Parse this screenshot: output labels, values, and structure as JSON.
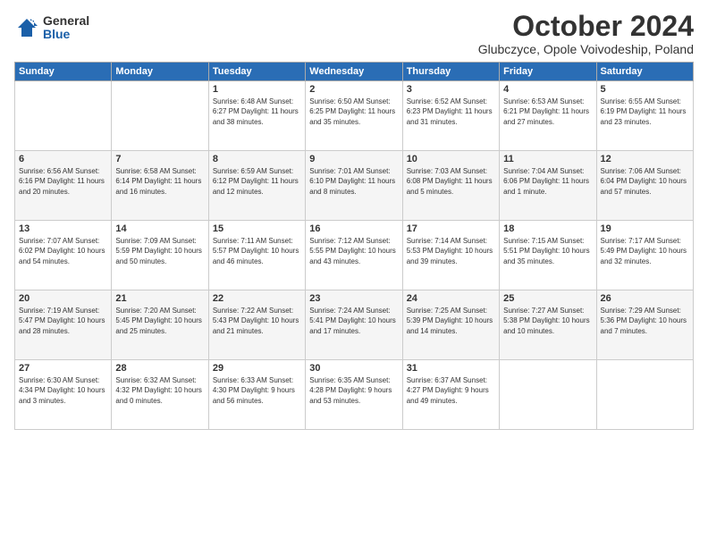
{
  "logo": {
    "general": "General",
    "blue": "Blue"
  },
  "title": "October 2024",
  "location": "Glubczyce, Opole Voivodeship, Poland",
  "weekdays": [
    "Sunday",
    "Monday",
    "Tuesday",
    "Wednesday",
    "Thursday",
    "Friday",
    "Saturday"
  ],
  "weeks": [
    [
      {
        "day": "",
        "info": ""
      },
      {
        "day": "",
        "info": ""
      },
      {
        "day": "1",
        "info": "Sunrise: 6:48 AM\nSunset: 6:27 PM\nDaylight: 11 hours\nand 38 minutes."
      },
      {
        "day": "2",
        "info": "Sunrise: 6:50 AM\nSunset: 6:25 PM\nDaylight: 11 hours\nand 35 minutes."
      },
      {
        "day": "3",
        "info": "Sunrise: 6:52 AM\nSunset: 6:23 PM\nDaylight: 11 hours\nand 31 minutes."
      },
      {
        "day": "4",
        "info": "Sunrise: 6:53 AM\nSunset: 6:21 PM\nDaylight: 11 hours\nand 27 minutes."
      },
      {
        "day": "5",
        "info": "Sunrise: 6:55 AM\nSunset: 6:19 PM\nDaylight: 11 hours\nand 23 minutes."
      }
    ],
    [
      {
        "day": "6",
        "info": "Sunrise: 6:56 AM\nSunset: 6:16 PM\nDaylight: 11 hours\nand 20 minutes."
      },
      {
        "day": "7",
        "info": "Sunrise: 6:58 AM\nSunset: 6:14 PM\nDaylight: 11 hours\nand 16 minutes."
      },
      {
        "day": "8",
        "info": "Sunrise: 6:59 AM\nSunset: 6:12 PM\nDaylight: 11 hours\nand 12 minutes."
      },
      {
        "day": "9",
        "info": "Sunrise: 7:01 AM\nSunset: 6:10 PM\nDaylight: 11 hours\nand 8 minutes."
      },
      {
        "day": "10",
        "info": "Sunrise: 7:03 AM\nSunset: 6:08 PM\nDaylight: 11 hours\nand 5 minutes."
      },
      {
        "day": "11",
        "info": "Sunrise: 7:04 AM\nSunset: 6:06 PM\nDaylight: 11 hours\nand 1 minute."
      },
      {
        "day": "12",
        "info": "Sunrise: 7:06 AM\nSunset: 6:04 PM\nDaylight: 10 hours\nand 57 minutes."
      }
    ],
    [
      {
        "day": "13",
        "info": "Sunrise: 7:07 AM\nSunset: 6:02 PM\nDaylight: 10 hours\nand 54 minutes."
      },
      {
        "day": "14",
        "info": "Sunrise: 7:09 AM\nSunset: 5:59 PM\nDaylight: 10 hours\nand 50 minutes."
      },
      {
        "day": "15",
        "info": "Sunrise: 7:11 AM\nSunset: 5:57 PM\nDaylight: 10 hours\nand 46 minutes."
      },
      {
        "day": "16",
        "info": "Sunrise: 7:12 AM\nSunset: 5:55 PM\nDaylight: 10 hours\nand 43 minutes."
      },
      {
        "day": "17",
        "info": "Sunrise: 7:14 AM\nSunset: 5:53 PM\nDaylight: 10 hours\nand 39 minutes."
      },
      {
        "day": "18",
        "info": "Sunrise: 7:15 AM\nSunset: 5:51 PM\nDaylight: 10 hours\nand 35 minutes."
      },
      {
        "day": "19",
        "info": "Sunrise: 7:17 AM\nSunset: 5:49 PM\nDaylight: 10 hours\nand 32 minutes."
      }
    ],
    [
      {
        "day": "20",
        "info": "Sunrise: 7:19 AM\nSunset: 5:47 PM\nDaylight: 10 hours\nand 28 minutes."
      },
      {
        "day": "21",
        "info": "Sunrise: 7:20 AM\nSunset: 5:45 PM\nDaylight: 10 hours\nand 25 minutes."
      },
      {
        "day": "22",
        "info": "Sunrise: 7:22 AM\nSunset: 5:43 PM\nDaylight: 10 hours\nand 21 minutes."
      },
      {
        "day": "23",
        "info": "Sunrise: 7:24 AM\nSunset: 5:41 PM\nDaylight: 10 hours\nand 17 minutes."
      },
      {
        "day": "24",
        "info": "Sunrise: 7:25 AM\nSunset: 5:39 PM\nDaylight: 10 hours\nand 14 minutes."
      },
      {
        "day": "25",
        "info": "Sunrise: 7:27 AM\nSunset: 5:38 PM\nDaylight: 10 hours\nand 10 minutes."
      },
      {
        "day": "26",
        "info": "Sunrise: 7:29 AM\nSunset: 5:36 PM\nDaylight: 10 hours\nand 7 minutes."
      }
    ],
    [
      {
        "day": "27",
        "info": "Sunrise: 6:30 AM\nSunset: 4:34 PM\nDaylight: 10 hours\nand 3 minutes."
      },
      {
        "day": "28",
        "info": "Sunrise: 6:32 AM\nSunset: 4:32 PM\nDaylight: 10 hours\nand 0 minutes."
      },
      {
        "day": "29",
        "info": "Sunrise: 6:33 AM\nSunset: 4:30 PM\nDaylight: 9 hours\nand 56 minutes."
      },
      {
        "day": "30",
        "info": "Sunrise: 6:35 AM\nSunset: 4:28 PM\nDaylight: 9 hours\nand 53 minutes."
      },
      {
        "day": "31",
        "info": "Sunrise: 6:37 AM\nSunset: 4:27 PM\nDaylight: 9 hours\nand 49 minutes."
      },
      {
        "day": "",
        "info": ""
      },
      {
        "day": "",
        "info": ""
      }
    ]
  ]
}
